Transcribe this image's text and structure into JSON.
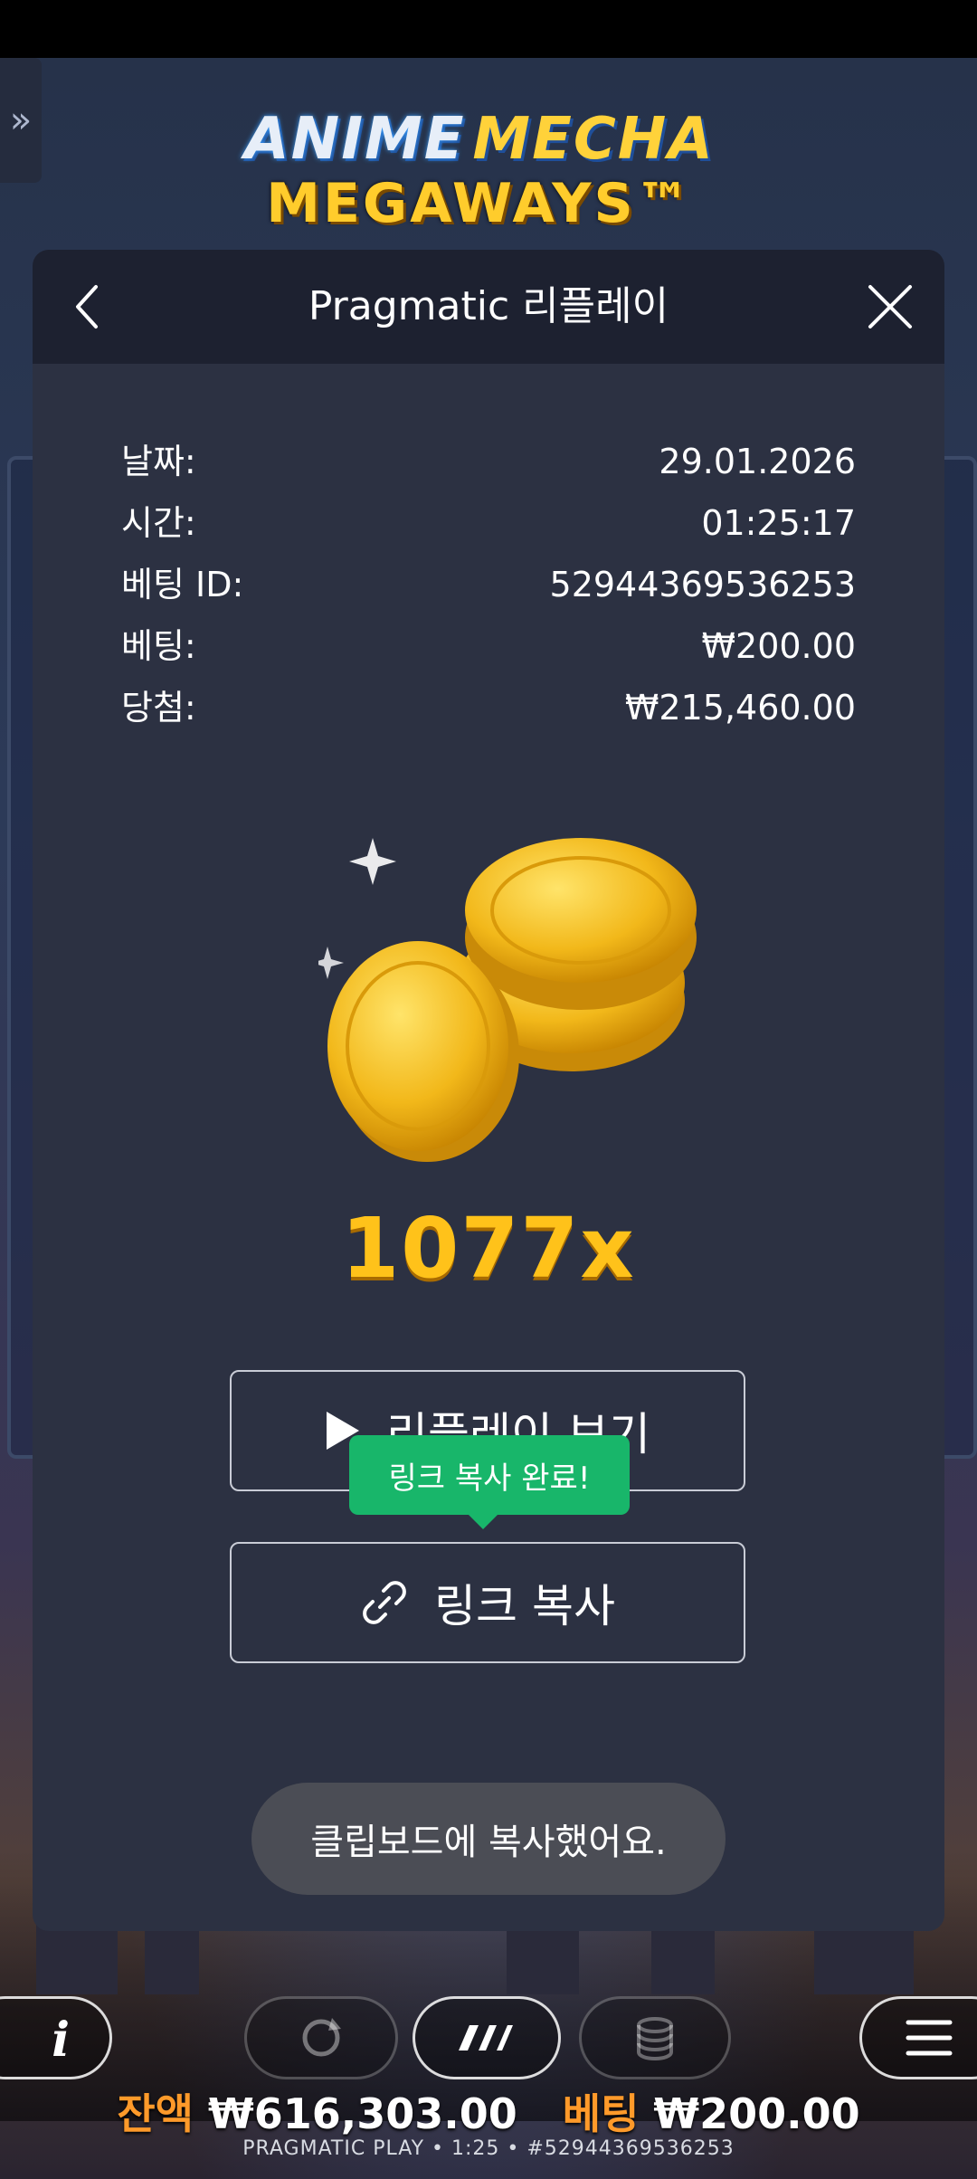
{
  "game": {
    "logo_line1_part1": "ANIME",
    "logo_line1_part2": "MECHA",
    "logo_line2": "MEGAWAYS™"
  },
  "side_tab": {
    "icon": "double-chevron-right-icon",
    "glyph": "»"
  },
  "modal": {
    "title": "Pragmatic 리플레이",
    "back_icon": "back-chevron-icon",
    "close_icon": "close-icon",
    "info": [
      {
        "label": "날짜:",
        "value": "29.01.2026"
      },
      {
        "label": "시간:",
        "value": "01:25:17"
      },
      {
        "label": "베팅 ID:",
        "value": "52944369536253"
      },
      {
        "label": "베팅:",
        "value": "₩200.00"
      },
      {
        "label": "당첨:",
        "value": "₩215,460.00"
      }
    ],
    "multiplier": "1077x",
    "replay_button": {
      "label": "리플레이 보기",
      "icon": "play-icon"
    },
    "copy_button": {
      "label": "링크 복사",
      "icon": "link-icon"
    },
    "tooltip": "링크 복사 완료!"
  },
  "toast": "클립보드에 복사했어요.",
  "controls": {
    "info_icon": "info-icon",
    "autoplay_icon": "autoplay-icon",
    "turbo_icon": "turbo-icon",
    "bet_icon": "coin-stack-icon",
    "menu_icon": "menu-icon"
  },
  "bottom": {
    "balance_label": "잔액",
    "balance_value": "₩616,303.00",
    "bet_label": "베팅",
    "bet_value": "₩200.00",
    "footer": "PRAGMATIC PLAY • 1:25 • #52944369536253"
  },
  "colors": {
    "modal_bg": "#2c3142",
    "modal_header_bg": "#1d2130",
    "tooltip_bg": "#18b66a",
    "multiplier": "#ffc21a",
    "bottom_label": "#ff9a2a"
  }
}
